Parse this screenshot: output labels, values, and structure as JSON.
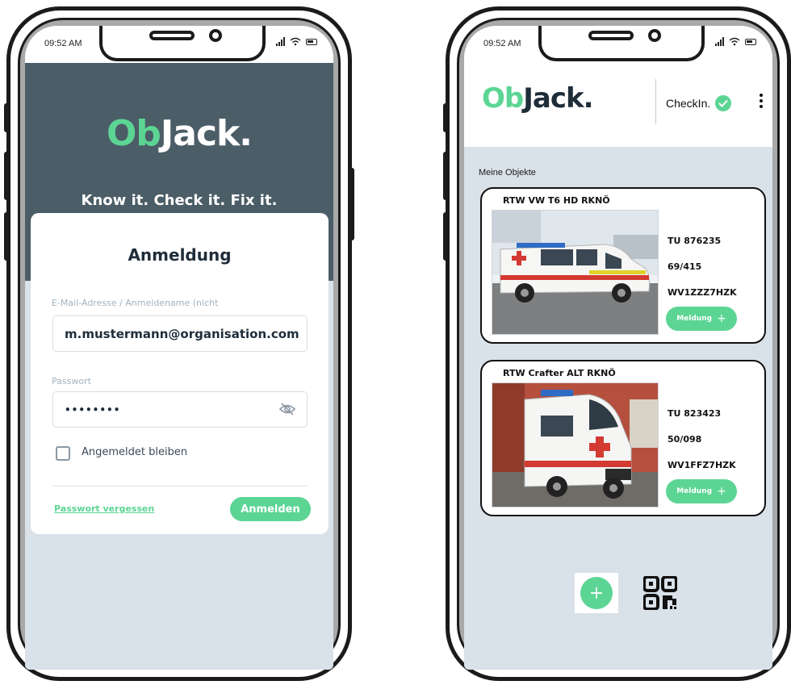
{
  "status_bar": {
    "time": "09:52 AM"
  },
  "login": {
    "logo_prefix": "Ob",
    "logo_suffix": "Jack.",
    "tagline": "Know it. Check it. Fix it.",
    "title": "Anmeldung",
    "email_label": "E-Mail-Adresse / Anmeldename (nicht",
    "email_value": "m.mustermann@organisation.com",
    "password_label": "Passwort",
    "password_value": "••••••••",
    "remember_label": "Angemeldet bleiben",
    "forgot_link": "Passwort vergessen",
    "submit_label": "Anmelden"
  },
  "objects_screen": {
    "logo_prefix": "Ob",
    "logo_suffix": "Jack.",
    "checkin_label": "CheckIn.",
    "section_title": "Meine Objekte",
    "objects": [
      {
        "name": "RTW VW T6 HD RKNÖ",
        "plate": "TU 876235",
        "code": "69/415",
        "vin": "WV1ZZZ7HZK",
        "button_label": "Meldung"
      },
      {
        "name": "RTW Crafter ALT RKNÖ",
        "plate": "TU 823423",
        "code": "50/098",
        "vin": "WV1FFZ7HZK",
        "button_label": "Meldung"
      }
    ]
  },
  "colors": {
    "accent": "#5cd594",
    "header_dark": "#4b5d67",
    "screen_background": "#d9e1e9",
    "text_dark": "#1f2d3a"
  },
  "icons": [
    "eye-slash-icon",
    "check-circle-icon",
    "more-vertical-icon",
    "plus-icon",
    "qr-code-icon",
    "signal-icon",
    "wifi-icon",
    "battery-icon"
  ]
}
